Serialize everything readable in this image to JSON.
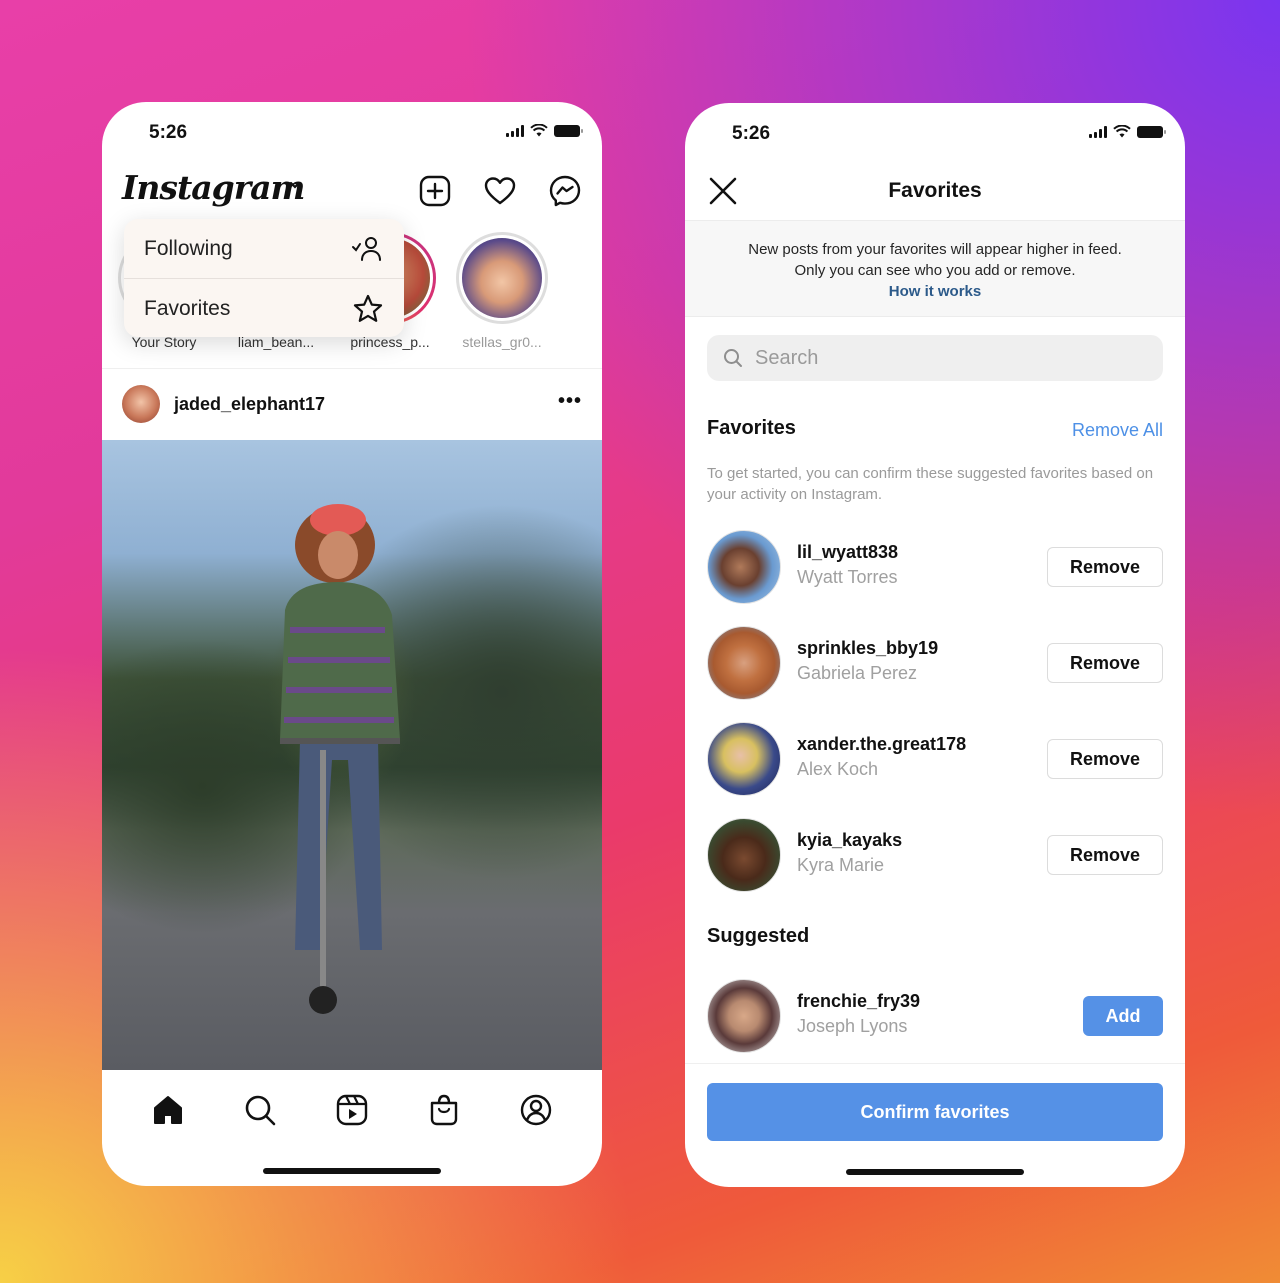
{
  "colors": {
    "accent_blue": "#5591e6",
    "link_blue": "#2c5a8a",
    "remove_all_blue": "#4d90e6",
    "muted_text": "#9a9a9a"
  },
  "left_phone": {
    "status": {
      "time": "5:26",
      "icons": [
        "cellular-signal-icon",
        "wifi-icon",
        "battery-icon"
      ]
    },
    "header": {
      "logo": "Instagram",
      "icons": [
        "chevron-down-icon",
        "new-post-icon",
        "heart-icon",
        "messenger-icon"
      ]
    },
    "dropdown": {
      "items": [
        {
          "label": "Following",
          "icon": "following-person-icon"
        },
        {
          "label": "Favorites",
          "icon": "star-icon"
        }
      ]
    },
    "stories": [
      {
        "name": "Your Story"
      },
      {
        "name": "liam_bean..."
      },
      {
        "name": "princess_p..."
      },
      {
        "name": "stellas_gr0..."
      }
    ],
    "post": {
      "username": "jaded_elephant17",
      "more": "•••"
    },
    "bottom_nav": [
      "home-icon",
      "search-icon",
      "reels-icon",
      "shop-icon",
      "profile-icon"
    ]
  },
  "right_phone": {
    "status": {
      "time": "5:26"
    },
    "nav": {
      "title": "Favorites"
    },
    "info": {
      "line1": "New posts from your favorites will appear higher in feed.",
      "line2": "Only you can see who you add or remove.",
      "link": "How it works"
    },
    "search": {
      "placeholder": "Search",
      "value": ""
    },
    "favorites_section": {
      "title": "Favorites",
      "action": "Remove All",
      "hint": "To get started, you can confirm these suggested favorites based on your activity on Instagram.",
      "items": [
        {
          "username": "lil_wyatt838",
          "full_name": "Wyatt Torres",
          "button": "Remove"
        },
        {
          "username": "sprinkles_bby19",
          "full_name": "Gabriela Perez",
          "button": "Remove"
        },
        {
          "username": "xander.the.great178",
          "full_name": "Alex Koch",
          "button": "Remove"
        },
        {
          "username": "kyia_kayaks",
          "full_name": "Kyra Marie",
          "button": "Remove"
        }
      ]
    },
    "suggested_section": {
      "title": "Suggested",
      "items": [
        {
          "username": "frenchie_fry39",
          "full_name": "Joseph Lyons",
          "button": "Add"
        }
      ]
    },
    "confirm_button": "Confirm favorites"
  }
}
